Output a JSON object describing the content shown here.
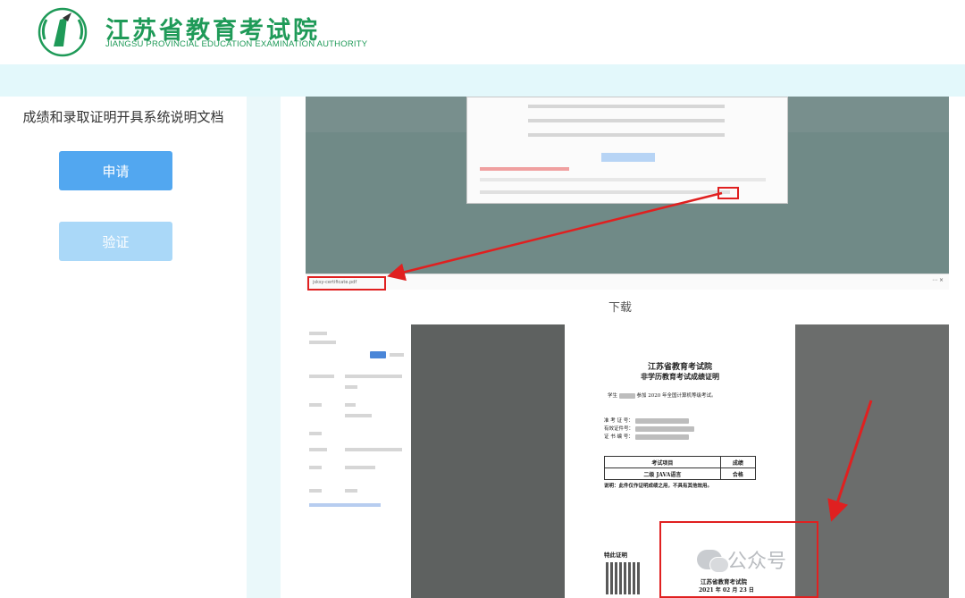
{
  "header": {
    "logo_cn": "江苏省教育考试院",
    "logo_en": "JIANGSU PROVINCIAL EDUCATION EXAMINATION AUTHORITY",
    "brand_color": "#1f9a58"
  },
  "sidebar": {
    "title": "成绩和录取证明开具系统说明文档",
    "apply_label": "申请",
    "verify_label": "验证",
    "apply_color": "#52a7f0",
    "verify_color": "#aad8f8"
  },
  "content": {
    "caption": "下载",
    "download_file": "jsksy-certificate.pdf",
    "certificate": {
      "org": "江苏省教育考试院",
      "title": "非学历教育考试成绩证明",
      "student_line_prefix": "学生",
      "student_line_suffix": "参加 2020 年全国计算机等级考试。",
      "fields": [
        "准 考 证 号：",
        "有效证件号：",
        "证 书 编 号："
      ],
      "table_headers": [
        "考试项目",
        "成绩"
      ],
      "table_row": [
        "二级 JAVA语言",
        "合格"
      ],
      "note": "说明：此件仅作证明成绩之用，不具有其他效用。",
      "special": "特此证明",
      "signer": "江苏省教育考试院",
      "date": "2021 年 02 月 23 日"
    }
  },
  "watermark": {
    "text": "公众号"
  },
  "annotation_color": "#e02020"
}
